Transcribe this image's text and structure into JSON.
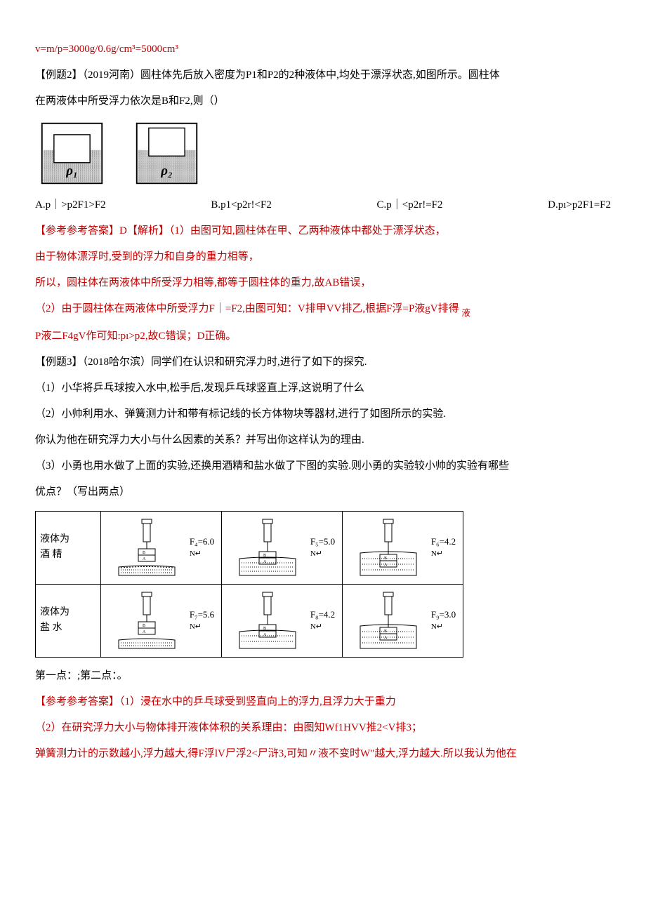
{
  "line1": "v=m/p=3000g/0.6g/cm³=5000cm³",
  "ex2_title": "【例题2】（2019河南）圆柱体先后放入密度为P1和P2的2种液体中,均处于漂浮状态,如图所示。圆柱体",
  "ex2_title2": "在两液体中所受浮力依次是B和F2,则（）",
  "beaker1_label": "ρ₁",
  "beaker2_label": "ρ₂",
  "options": {
    "a": "A.p｜>p2F1>F2",
    "b": "B.p1<p2r!<F2",
    "c": "C.p｜<p2r!=F2",
    "d": "D.pı>p2F1=F2"
  },
  "ans2_1": "【参考参考答案】D【解析】（1）由图可知,圆柱体在甲、乙两种液体中都处于漂浮状态，",
  "ans2_2": "由于物体漂浮时,受到的浮力和自身的重力相等，",
  "ans2_3": "所以，圆柱体在两液体中所受浮力相等,都等于圆柱体的重力,故AB错误，",
  "ans2_4": "（2）由于圆柱体在两液体中所受浮力F｜=F2,由图可知：V排甲VV排乙,根据F浮=P液gV排得",
  "ans2_5": "P液二F4gV作可知:pı>p2,故C错误；D正确。",
  "ex3_title": "【例题3】（2018哈尔滨）同学们在认识和研究浮力时,进行了如下的探究.",
  "ex3_q1": "（1）小华将乒乓球按入水中,松手后,发现乒乓球竖直上浮,这说明了什么",
  "ex3_q2": "（2）小帅利用水、弹簧测力计和带有标记线的长方体物块等器材,进行了如图所示的实验.",
  "ex3_q2b": "你认为他在研究浮力大小与什么因素的关系？并写出你这样认为的理由.",
  "ex3_q3a": "（3）小勇也用水做了上面的实验,还换用酒精和盐水做了下图的实验.则小勇的实验较小帅的实验有哪些",
  "ex3_q3b": "优点？（写出两点）",
  "tbl_row1_label_a": "液体为",
  "tbl_row1_label_b": "酒 精",
  "tbl_row2_label_a": "液体为",
  "tbl_row2_label_b": "盐 水",
  "readings": {
    "f4": {
      "sym": "F₄=6.0",
      "unit": "N↵"
    },
    "f5": {
      "sym": "F₅=5.0",
      "unit": "N↵"
    },
    "f6": {
      "sym": "F₆=4.2",
      "unit": "N↵"
    },
    "f7": {
      "sym": "F₇=5.6",
      "unit": "N↵"
    },
    "f8": {
      "sym": "F₈=4.2",
      "unit": "N↵"
    },
    "f9": {
      "sym": "F₉=3.0",
      "unit": "N↵"
    }
  },
  "pts_line": "第一点：;第二点：。",
  "ans3_1": "【参考参考答案】（1）浸在水中的乒乓球受到竖直向上的浮力,且浮力大于重力",
  "ans3_2": "（2）在研究浮力大小与物体排开液体体积的关系理由：由图知Wf1HVV推2<V排3；",
  "ans3_3": "弹簧测力计的示数越小,浮力越大,得F浮lV尸浮2<尸浒3,可知〃液不变时W\"越大,浮力越大.所以我认为他在"
}
